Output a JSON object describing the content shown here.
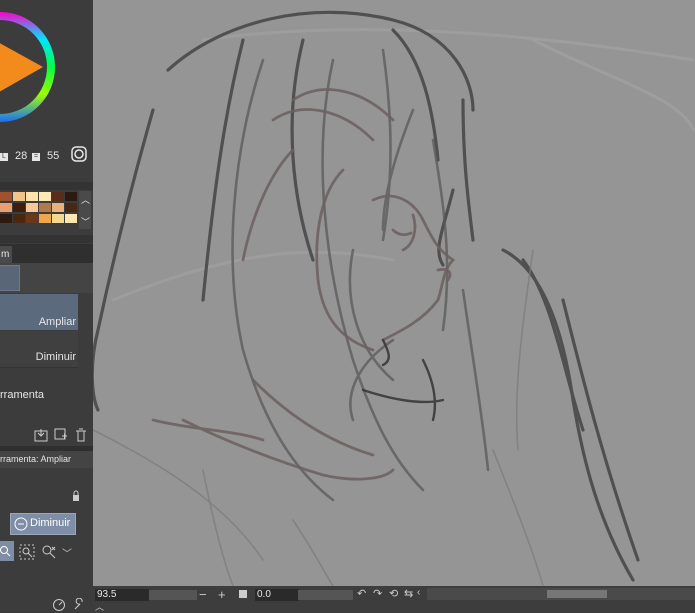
{
  "color_panel": {
    "value_a": "28",
    "value_b": "55"
  },
  "layer_tab": {
    "label": "m"
  },
  "subtool": {
    "items": [
      "Ampliar",
      "Diminuir"
    ],
    "tool_label": "rramenta"
  },
  "tool_property": {
    "title": "rramenta: Ampliar",
    "diminuir_button": "Diminuir"
  },
  "status": {
    "zoom": "93.5",
    "rotation": "0.0"
  },
  "colors": {
    "panel_bg": "#3c3c3c",
    "canvas_bg": "#959595",
    "accent": "#596678"
  }
}
